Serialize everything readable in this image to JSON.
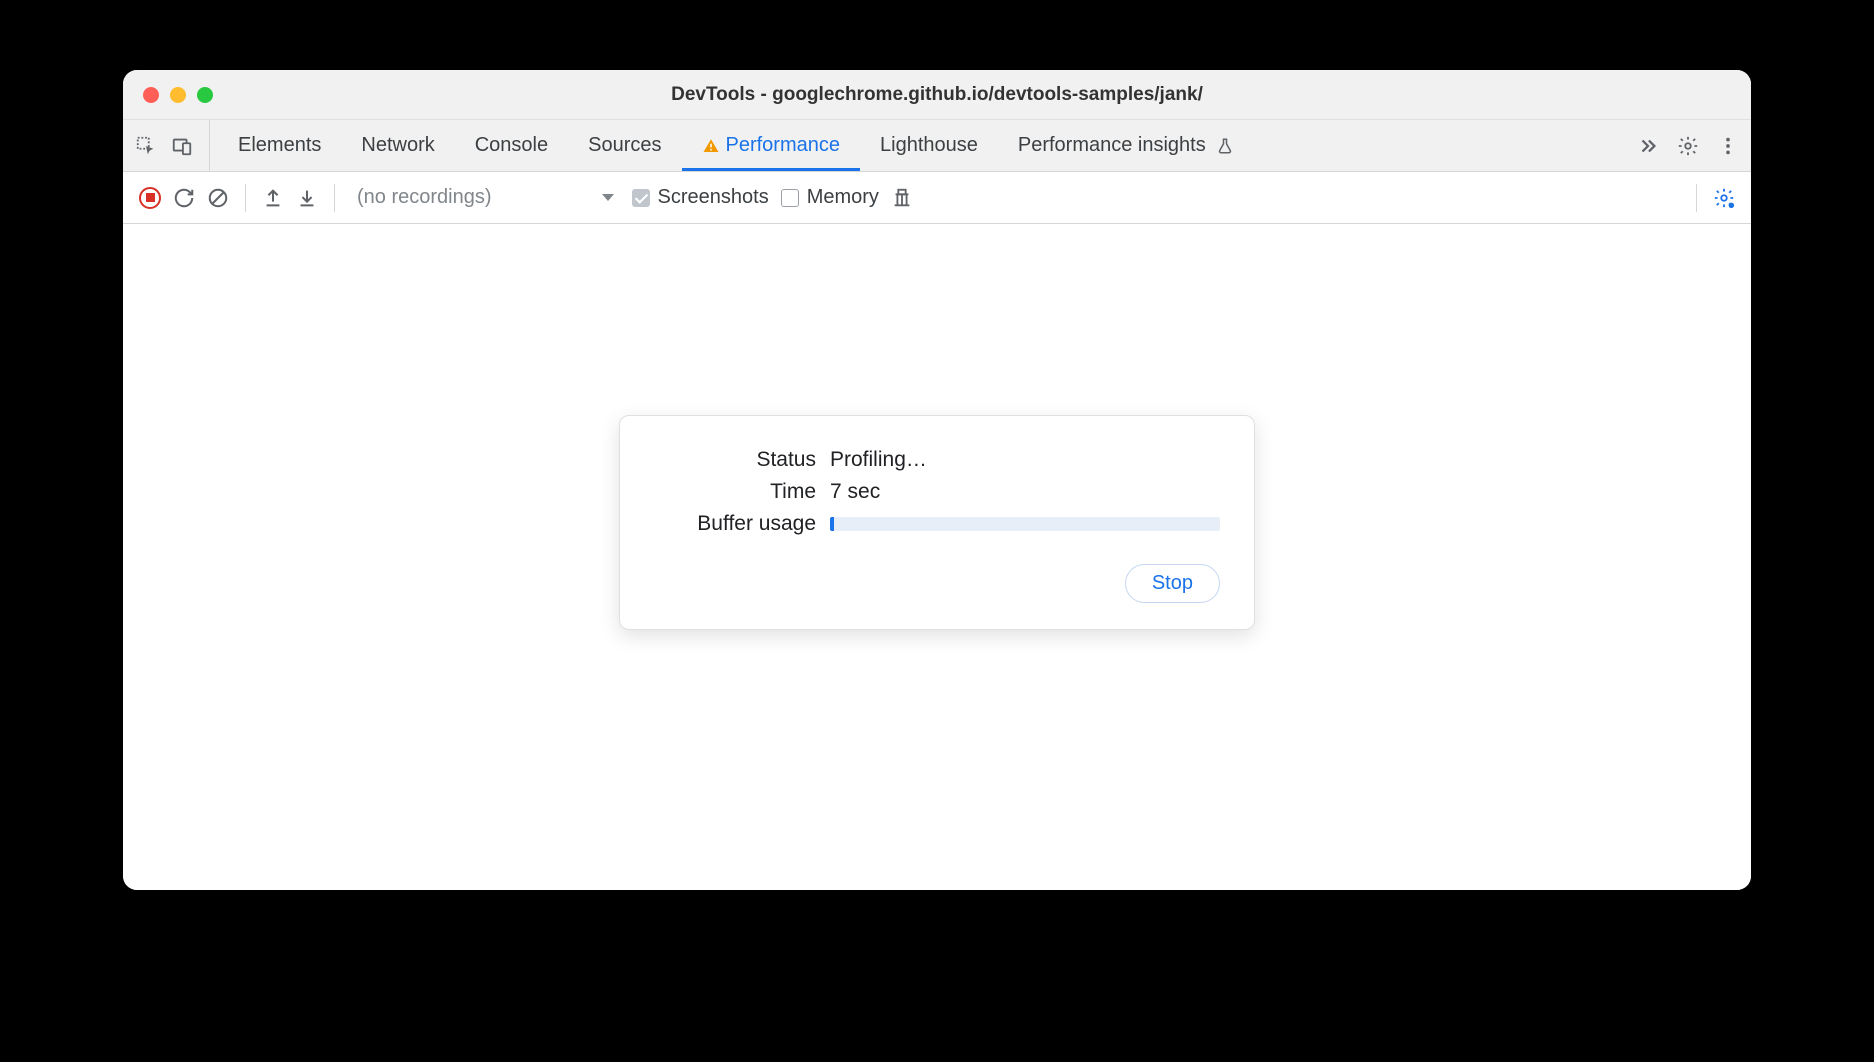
{
  "window": {
    "title": "DevTools - googlechrome.github.io/devtools-samples/jank/"
  },
  "tabs": {
    "elements": "Elements",
    "network": "Network",
    "console": "Console",
    "sources": "Sources",
    "performance": "Performance",
    "lighthouse": "Lighthouse",
    "performance_insights": "Performance insights"
  },
  "toolbar": {
    "recordings_placeholder": "(no recordings)",
    "screenshots_label": "Screenshots",
    "memory_label": "Memory",
    "screenshots_checked": true,
    "memory_checked": false
  },
  "dialog": {
    "status_label": "Status",
    "status_value": "Profiling…",
    "time_label": "Time",
    "time_value": "7 sec",
    "buffer_label": "Buffer usage",
    "buffer_percent": 1,
    "stop_label": "Stop"
  }
}
